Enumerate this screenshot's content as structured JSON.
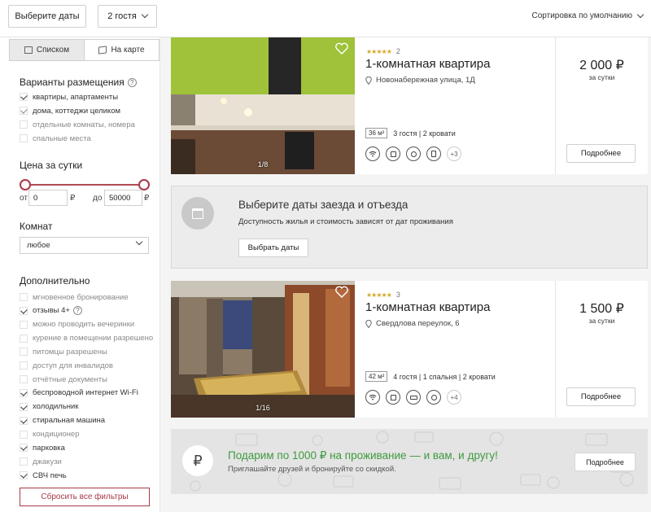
{
  "topbar": {
    "dates_label": "Выберите даты",
    "guests_label": "2 гостя",
    "sort_label": "Сортировка по умолчанию"
  },
  "sidebar": {
    "view_list": "Списком",
    "view_map": "На карте",
    "accommodation_title": "Варианты размещения",
    "accommodation": [
      {
        "label": "квартиры, апартаменты",
        "checked": true
      },
      {
        "label": "дома, коттеджи целиком",
        "checked": true
      },
      {
        "label": "отдельные комнаты, номера",
        "checked": false
      },
      {
        "label": "спальные места",
        "checked": false
      }
    ],
    "price_title": "Цена за сутки",
    "price_from_label": "от",
    "price_from": "0",
    "price_to_label": "до",
    "price_to": "50000",
    "currency": "₽",
    "rooms_title": "Комнат",
    "rooms_value": "любое",
    "extra_title": "Дополнительно",
    "extra": [
      {
        "label": "мгновенное бронирование",
        "checked": false
      },
      {
        "label": "отзывы 4+",
        "checked": true
      },
      {
        "label": "можно проводить вечеринки",
        "checked": false
      },
      {
        "label": "курение в помещении разрешено",
        "checked": false
      },
      {
        "label": "питомцы разрешены",
        "checked": false
      },
      {
        "label": "доступ для инвалидов",
        "checked": false
      },
      {
        "label": "отчётные документы",
        "checked": false
      },
      {
        "label": "беспроводной интернет Wi-Fi",
        "checked": true
      },
      {
        "label": "холодильник",
        "checked": true
      },
      {
        "label": "стиральная машина",
        "checked": true
      },
      {
        "label": "кондиционер",
        "checked": false
      },
      {
        "label": "парковка",
        "checked": true
      },
      {
        "label": "джакузи",
        "checked": false
      },
      {
        "label": "СВЧ печь",
        "checked": true
      }
    ],
    "reset_label": "Сбросить все фильтры"
  },
  "listings": [
    {
      "stars": "★★★★★",
      "reviews": "2",
      "title": "1-комнатная квартира",
      "address": "Новонабережная улица, 1Д",
      "area": "36 м²",
      "specs": "3 гостя | 2 кровати",
      "amenities_more": "+3",
      "price": "2 000 ₽",
      "per": "за сутки",
      "photo_count": "1/8",
      "more_label": "Подробнее"
    },
    {
      "stars": "★★★★★",
      "reviews": "3",
      "title": "1-комнатная квартира",
      "address": "Свердлова переулок, 6",
      "area": "42 м²",
      "specs": "4 гостя | 1 спальня | 2 кровати",
      "amenities_more": "+4",
      "price": "1 500 ₽",
      "per": "за сутки",
      "photo_count": "1/16",
      "more_label": "Подробнее"
    }
  ],
  "dates_banner": {
    "title": "Выберите даты заезда и отъезда",
    "subtitle": "Доступность жилья и стоимость зависят от дат проживания",
    "button": "Выбрать даты"
  },
  "promo": {
    "icon_text": "₽",
    "title": "Подарим по 1000 ₽ на проживание — и вам, и другу!",
    "subtitle": "Приглашайте друзей и бронируйте со скидкой.",
    "button": "Подробнее"
  },
  "colors": {
    "accent": "#a83a48",
    "promo_green": "#3f9a3f",
    "star": "#d5a829"
  }
}
